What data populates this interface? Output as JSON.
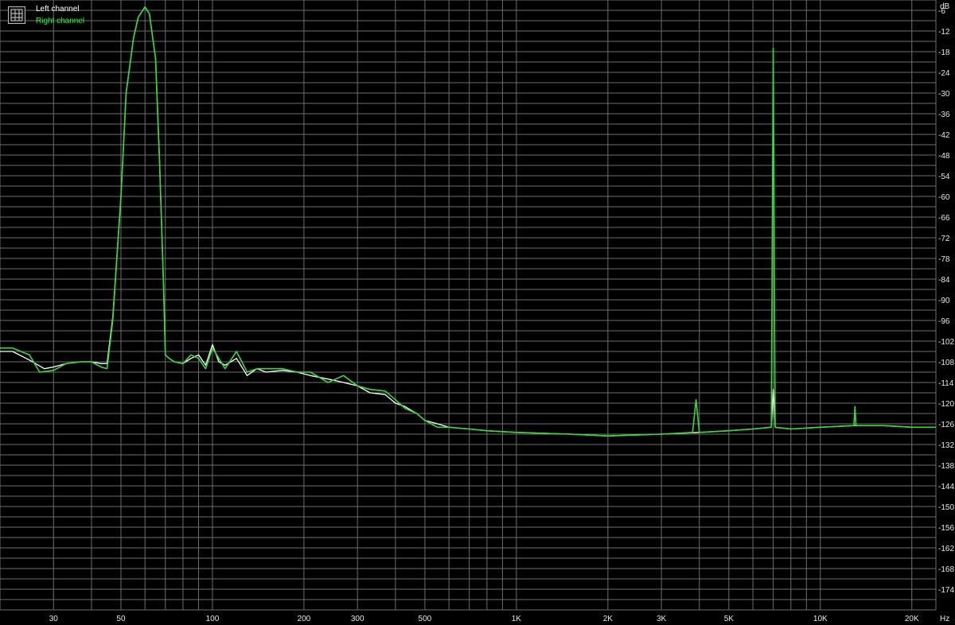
{
  "chart_data": {
    "type": "line",
    "title": "",
    "xlabel": "Hz",
    "ylabel": "dB",
    "x_scale": "log",
    "xlim": [
      20,
      24000
    ],
    "ylim": [
      -180,
      -3
    ],
    "grid": true,
    "legend_position": "top-left",
    "background": "#000000",
    "grid_color": "#6e6e6e",
    "x_ticks": [
      30,
      50,
      100,
      200,
      300,
      500,
      1000,
      2000,
      3000,
      5000,
      10000,
      20000
    ],
    "x_tick_labels": [
      "30",
      "50",
      "100",
      "200",
      "300",
      "500",
      "1K",
      "2K",
      "3K",
      "5K",
      "10K",
      "20K"
    ],
    "y_ticks": [
      -6,
      -12,
      -18,
      -24,
      -30,
      -36,
      -42,
      -48,
      -54,
      -60,
      -66,
      -72,
      -78,
      -84,
      -90,
      -96,
      -102,
      -108,
      -114,
      -120,
      -126,
      -132,
      -138,
      -144,
      -150,
      -156,
      -162,
      -168,
      -174
    ],
    "series": [
      {
        "name": "Left channel",
        "color": "#ffffff",
        "points": [
          [
            20,
            -105
          ],
          [
            22,
            -105
          ],
          [
            25,
            -107.5
          ],
          [
            28,
            -110
          ],
          [
            30,
            -109.5
          ],
          [
            33,
            -108.5
          ],
          [
            37,
            -108
          ],
          [
            40,
            -108
          ],
          [
            43,
            -108.5
          ],
          [
            45,
            -108.5
          ],
          [
            47,
            -95
          ],
          [
            50,
            -60
          ],
          [
            52,
            -30
          ],
          [
            55,
            -14
          ],
          [
            57,
            -8
          ],
          [
            60,
            -5
          ],
          [
            62,
            -7
          ],
          [
            65,
            -20
          ],
          [
            67,
            -50
          ],
          [
            69,
            -85
          ],
          [
            70,
            -106
          ],
          [
            72,
            -107
          ],
          [
            75,
            -108
          ],
          [
            80,
            -108.5
          ],
          [
            85,
            -107
          ],
          [
            90,
            -106
          ],
          [
            95,
            -109
          ],
          [
            100,
            -103
          ],
          [
            105,
            -108
          ],
          [
            110,
            -109
          ],
          [
            120,
            -107
          ],
          [
            130,
            -112
          ],
          [
            140,
            -110
          ],
          [
            150,
            -111
          ],
          [
            170,
            -110.5
          ],
          [
            190,
            -111
          ],
          [
            210,
            -112
          ],
          [
            240,
            -113
          ],
          [
            270,
            -114
          ],
          [
            300,
            -115
          ],
          [
            330,
            -117
          ],
          [
            370,
            -117.5
          ],
          [
            400,
            -120
          ],
          [
            430,
            -121
          ],
          [
            470,
            -123
          ],
          [
            500,
            -125
          ],
          [
            550,
            -126
          ],
          [
            600,
            -127
          ],
          [
            700,
            -127.5
          ],
          [
            800,
            -128
          ],
          [
            1000,
            -128.5
          ],
          [
            1500,
            -129
          ],
          [
            2000,
            -129.5
          ],
          [
            3000,
            -129
          ],
          [
            4000,
            -128.5
          ],
          [
            5000,
            -128
          ],
          [
            6000,
            -127.5
          ],
          [
            6900,
            -127
          ],
          [
            7000,
            -116
          ],
          [
            7100,
            -127
          ],
          [
            8000,
            -127.5
          ],
          [
            10000,
            -127
          ],
          [
            13000,
            -126.5
          ],
          [
            16000,
            -126.5
          ],
          [
            20000,
            -127
          ],
          [
            24000,
            -127
          ]
        ]
      },
      {
        "name": "Right channel",
        "color": "#33dd33",
        "points": [
          [
            20,
            -104
          ],
          [
            22,
            -104
          ],
          [
            25,
            -106
          ],
          [
            27,
            -111
          ],
          [
            30,
            -110.5
          ],
          [
            33,
            -108.5
          ],
          [
            37,
            -108
          ],
          [
            40,
            -108
          ],
          [
            43,
            -109.5
          ],
          [
            45,
            -110
          ],
          [
            47,
            -96
          ],
          [
            50,
            -60
          ],
          [
            52,
            -30
          ],
          [
            55,
            -14
          ],
          [
            57,
            -8
          ],
          [
            60,
            -5
          ],
          [
            62,
            -7
          ],
          [
            65,
            -20
          ],
          [
            67,
            -50
          ],
          [
            69,
            -85
          ],
          [
            70,
            -106
          ],
          [
            72,
            -107
          ],
          [
            75,
            -108
          ],
          [
            80,
            -108.5
          ],
          [
            85,
            -106
          ],
          [
            90,
            -107
          ],
          [
            95,
            -110
          ],
          [
            100,
            -104
          ],
          [
            105,
            -107
          ],
          [
            110,
            -110
          ],
          [
            120,
            -105
          ],
          [
            130,
            -111
          ],
          [
            140,
            -110
          ],
          [
            150,
            -110
          ],
          [
            170,
            -110
          ],
          [
            190,
            -111
          ],
          [
            210,
            -111
          ],
          [
            240,
            -114
          ],
          [
            270,
            -112
          ],
          [
            300,
            -115
          ],
          [
            330,
            -116
          ],
          [
            370,
            -116.5
          ],
          [
            400,
            -119
          ],
          [
            430,
            -121.5
          ],
          [
            470,
            -123
          ],
          [
            500,
            -125
          ],
          [
            550,
            -127
          ],
          [
            600,
            -127
          ],
          [
            700,
            -127.5
          ],
          [
            800,
            -128
          ],
          [
            1000,
            -128.5
          ],
          [
            1500,
            -129
          ],
          [
            2000,
            -129.5
          ],
          [
            3000,
            -129
          ],
          [
            3800,
            -128.5
          ],
          [
            3900,
            -119
          ],
          [
            4000,
            -128.5
          ],
          [
            5000,
            -128
          ],
          [
            6000,
            -127.5
          ],
          [
            6900,
            -127
          ],
          [
            7000,
            -17
          ],
          [
            7100,
            -127
          ],
          [
            8000,
            -127.5
          ],
          [
            10000,
            -127
          ],
          [
            12900,
            -126.5
          ],
          [
            13000,
            -121
          ],
          [
            13100,
            -126.5
          ],
          [
            16000,
            -126.5
          ],
          [
            20000,
            -127
          ],
          [
            24000,
            -127
          ]
        ]
      }
    ]
  }
}
